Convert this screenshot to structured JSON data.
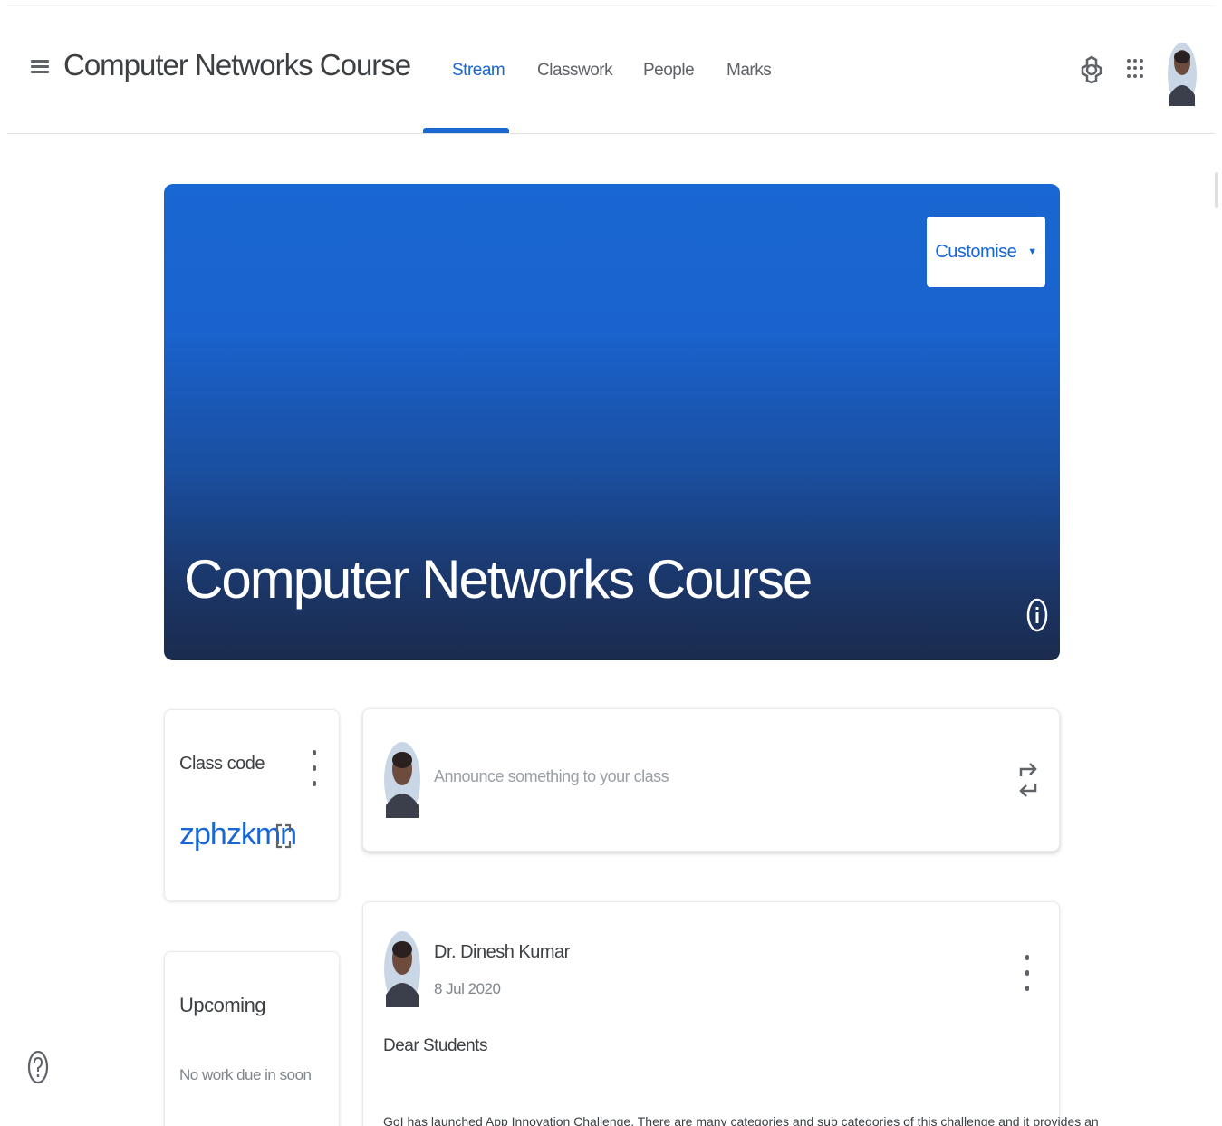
{
  "header": {
    "title": "Computer Networks Course",
    "tabs": [
      {
        "label": "Stream",
        "active": true
      },
      {
        "label": "Classwork",
        "active": false
      },
      {
        "label": "People",
        "active": false
      },
      {
        "label": "Marks",
        "active": false
      }
    ],
    "icons": [
      "menu-icon",
      "settings-icon",
      "apps-grid-icon",
      "profile-avatar"
    ]
  },
  "banner": {
    "title": "Computer Networks Course",
    "customise_label": "Customise",
    "customise_caret": "▼",
    "gradient_top": "#1967d2",
    "gradient_bottom": "#1a2c4e"
  },
  "class_code": {
    "label": "Class code",
    "value": "zphzkmn"
  },
  "upcoming": {
    "title": "Upcoming",
    "empty_text": "No work due in soon"
  },
  "announce": {
    "placeholder": "Announce something to your class"
  },
  "post": {
    "author": "Dr. Dinesh Kumar",
    "date": "8 Jul 2020",
    "greeting": "Dear Students",
    "body": "GoI has launched App Innovation Challenge. There are many categories and sub categories of this challenge and it provides an"
  },
  "colors": {
    "accent": "#1967d2",
    "text": "#3c4043",
    "muted": "#80868b"
  }
}
